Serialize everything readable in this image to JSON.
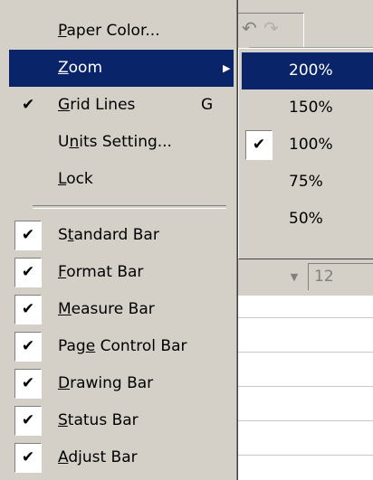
{
  "background": {
    "font_size_value": "12",
    "undo_glyph": "↶",
    "redo_glyph": "↷",
    "dropdown_glyph": "▼"
  },
  "view_menu": {
    "paper_color": {
      "pre": "",
      "key": "P",
      "post": "aper Color..."
    },
    "zoom": {
      "pre": "",
      "key": "Z",
      "post": "oom",
      "arrow": "▶"
    },
    "grid_lines": {
      "pre": "",
      "key": "G",
      "post": "rid Lines",
      "shortcut": "G",
      "check": "✔"
    },
    "units_setting": {
      "pre": "U",
      "key": "n",
      "post": "its Setting..."
    },
    "lock": {
      "pre": "",
      "key": "L",
      "post": "ock"
    },
    "standard_bar": {
      "pre": "S",
      "key": "t",
      "post": "andard Bar",
      "check": "✔"
    },
    "format_bar": {
      "pre": "",
      "key": "F",
      "post": "ormat Bar",
      "check": "✔"
    },
    "measure_bar": {
      "pre": "",
      "key": "M",
      "post": "easure Bar",
      "check": "✔"
    },
    "page_control_bar": {
      "pre": "Pag",
      "key": "e",
      "post": " Control Bar",
      "check": "✔"
    },
    "drawing_bar": {
      "pre": "",
      "key": "D",
      "post": "rawing Bar",
      "check": "✔"
    },
    "status_bar": {
      "pre": "",
      "key": "S",
      "post": "tatus Bar",
      "check": "✔"
    },
    "adjust_bar": {
      "pre": "",
      "key": "A",
      "post": "djust Bar",
      "check": "✔"
    }
  },
  "zoom_submenu": {
    "items": [
      {
        "label": "200%",
        "checked": false,
        "highlighted": true
      },
      {
        "label": "150%",
        "checked": false,
        "highlighted": false
      },
      {
        "label": "100%",
        "checked": true,
        "highlighted": false
      },
      {
        "label": "75%",
        "checked": false,
        "highlighted": false
      },
      {
        "label": "50%",
        "checked": false,
        "highlighted": false
      }
    ],
    "check_glyph": "✔"
  },
  "colors": {
    "menu_bg": "#d4d0c8",
    "highlight_bg": "#0a246a",
    "highlight_text": "#ffffff"
  }
}
